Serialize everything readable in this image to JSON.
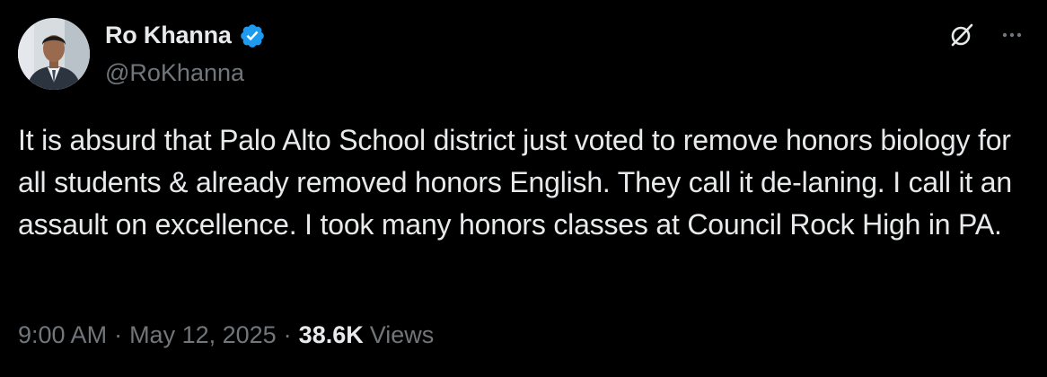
{
  "author": {
    "display_name": "Ro Khanna",
    "handle": "@RoKhanna",
    "verified": true,
    "verified_color": "#1d9bf0",
    "avatar_icon": "profile-photo"
  },
  "tweet": {
    "text": "It is absurd that Palo Alto School district just voted to remove honors biology for all students & already removed honors English. They call it de-laning. I call it an assault on excellence. I took many honors classes at Council Rock High in PA."
  },
  "meta": {
    "time": "9:00 AM",
    "separator": "·",
    "date": "May 12, 2025",
    "views_count": "38.6K",
    "views_label": "Views"
  },
  "actions": {
    "grok_icon": "grok-icon",
    "more_icon": "more-icon"
  },
  "colors": {
    "background": "#000000",
    "primary_text": "#e7e9ea",
    "secondary_text": "#71767b",
    "accent": "#1d9bf0"
  }
}
